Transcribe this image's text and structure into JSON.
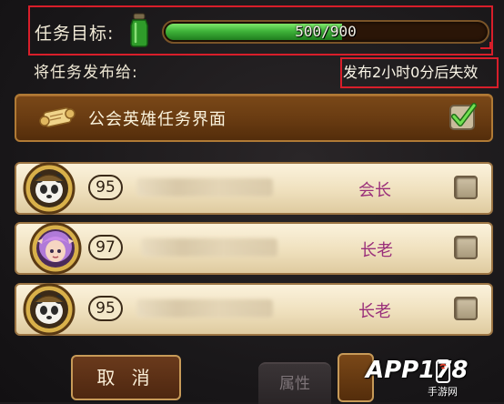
{
  "goal": {
    "label": "任务目标:",
    "progress_current": 500,
    "progress_max": 900,
    "progress_text": "500/900"
  },
  "publish": {
    "label": "将任务发布给:",
    "expiry": "发布2小时0分后失效"
  },
  "guild": {
    "label": "公会英雄任务界面",
    "checked": true
  },
  "members": [
    {
      "level": "95",
      "rank": "会长",
      "checked": false,
      "avatar": "panda-warrior"
    },
    {
      "level": "97",
      "rank": "长老",
      "checked": false,
      "avatar": "purple-hair-girl"
    },
    {
      "level": "95",
      "rank": "长老",
      "checked": false,
      "avatar": "panda-warrior"
    }
  ],
  "buttons": {
    "cancel": "取 消",
    "attr_tab": "属性"
  },
  "watermark": {
    "text": "APP178",
    "sub": "手游网"
  },
  "colors": {
    "highlight_box": "#d81e2a",
    "progress_fill": "#3fb43a",
    "rank_text": "#9a2f7a"
  }
}
